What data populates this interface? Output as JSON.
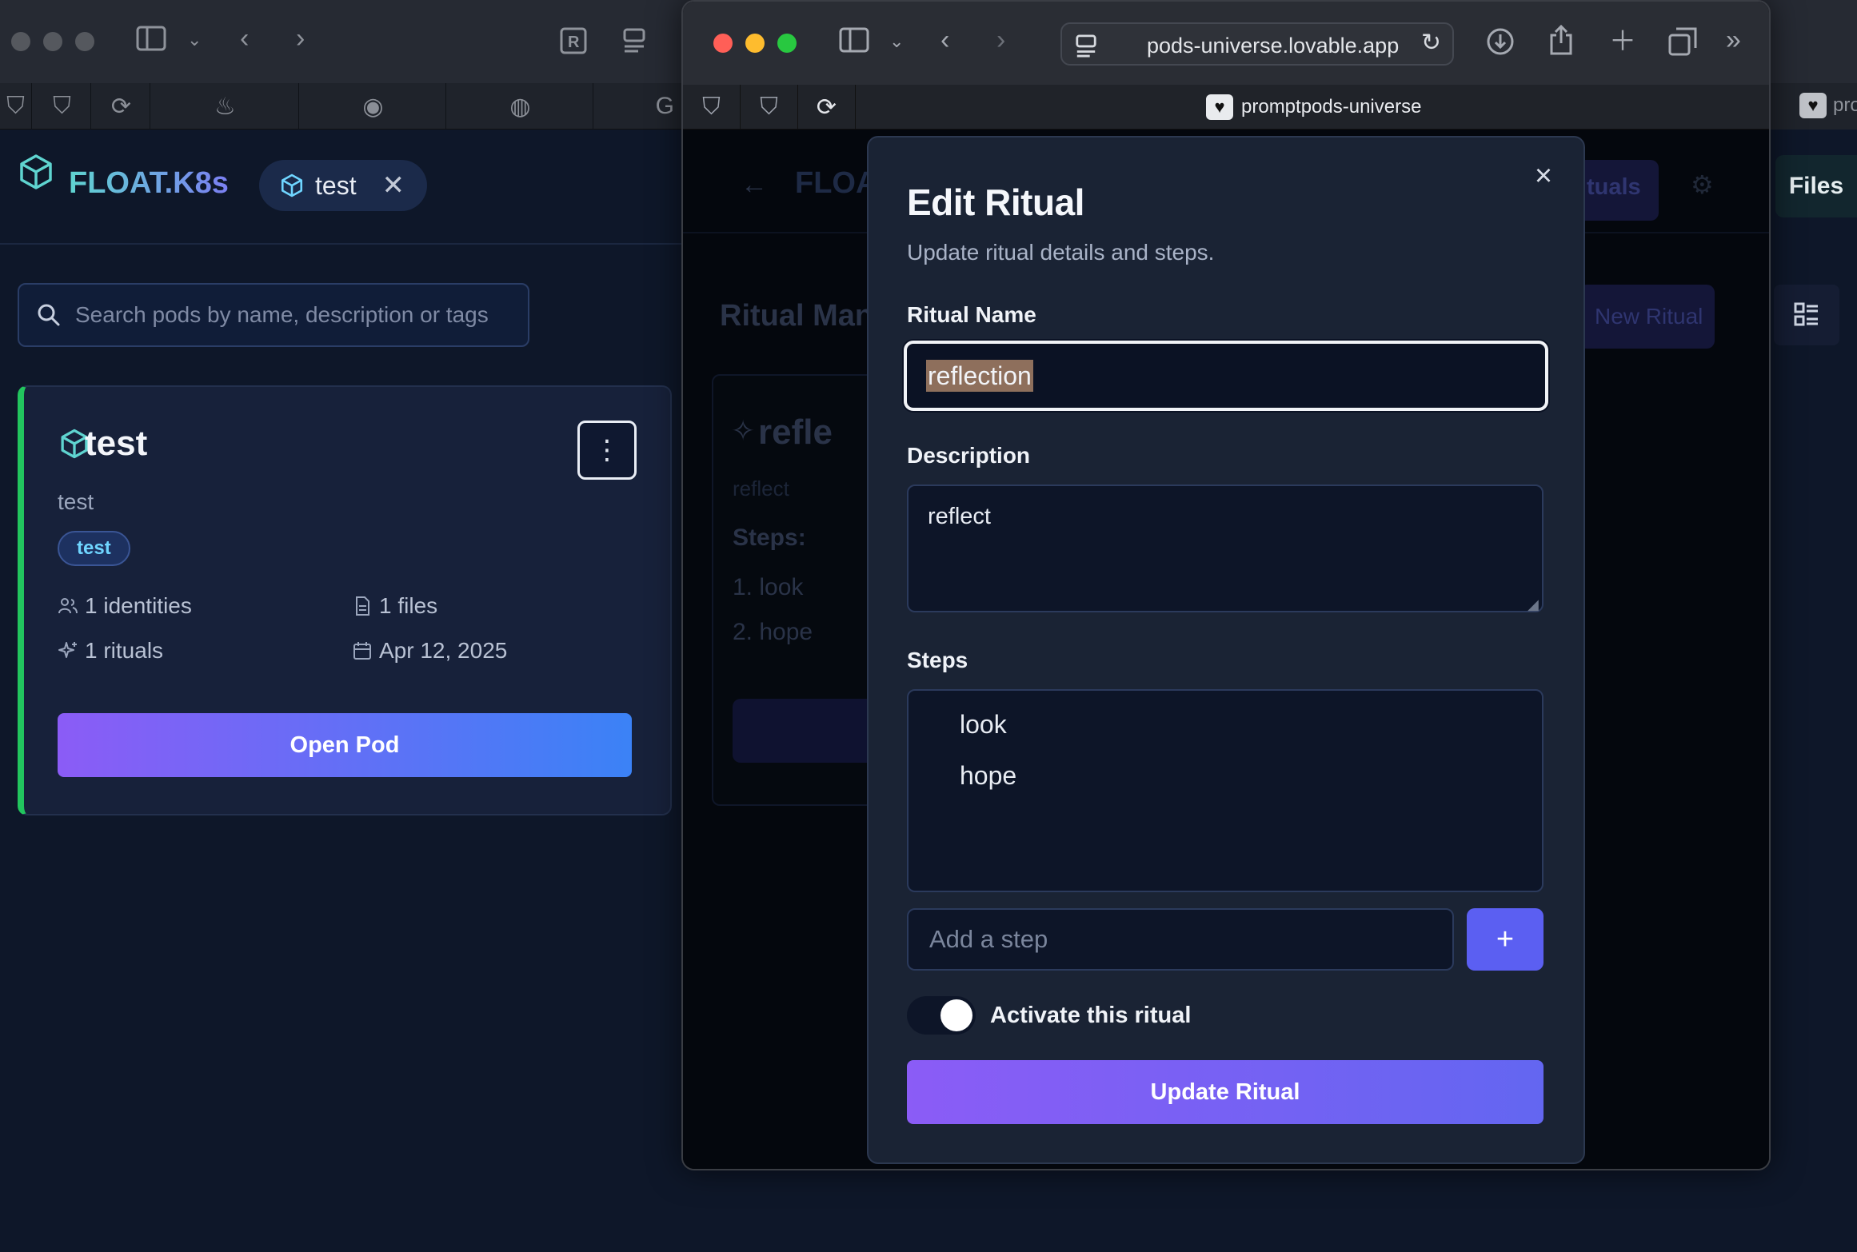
{
  "back": {
    "brand": "FLOAT.K8s",
    "chip_label": "test",
    "search_placeholder": "Search pods by name, description or tags",
    "card": {
      "title": "test",
      "description": "test",
      "tag": "test",
      "identities": "1 identities",
      "files": "1 files",
      "rituals": "1 rituals",
      "date": "Apr 12, 2025",
      "open_button": "Open Pod"
    }
  },
  "front": {
    "url": "pods-universe.lovable.app",
    "tab_title": "promptpods-universe",
    "bg_brand": "FLOA",
    "bg_page_title": "Ritual Man",
    "bg_ritual_title": "refle",
    "bg_ritual_desc": "reflect",
    "bg_steps_label": "Steps:",
    "bg_step1": "1.  look",
    "bg_step2": "2.  hope",
    "bg_rituals_tab": "tuals",
    "bg_new_ritual": "New Ritual"
  },
  "strip": {
    "files_button": "Files",
    "tab_title": "pro"
  },
  "modal": {
    "title": "Edit Ritual",
    "subtitle": "Update ritual details and steps.",
    "name_label": "Ritual Name",
    "name_value": "reflection",
    "description_label": "Description",
    "description_value": "reflect",
    "steps_label": "Steps",
    "steps": [
      "look",
      "hope"
    ],
    "add_step_placeholder": "Add a step",
    "add_step_button": "+",
    "toggle_label": "Activate this ritual",
    "submit": "Update Ritual"
  },
  "colors": {
    "accent": "#5b5ff2",
    "card_border": "#22c55e",
    "highlight": "#8e6f5c"
  }
}
